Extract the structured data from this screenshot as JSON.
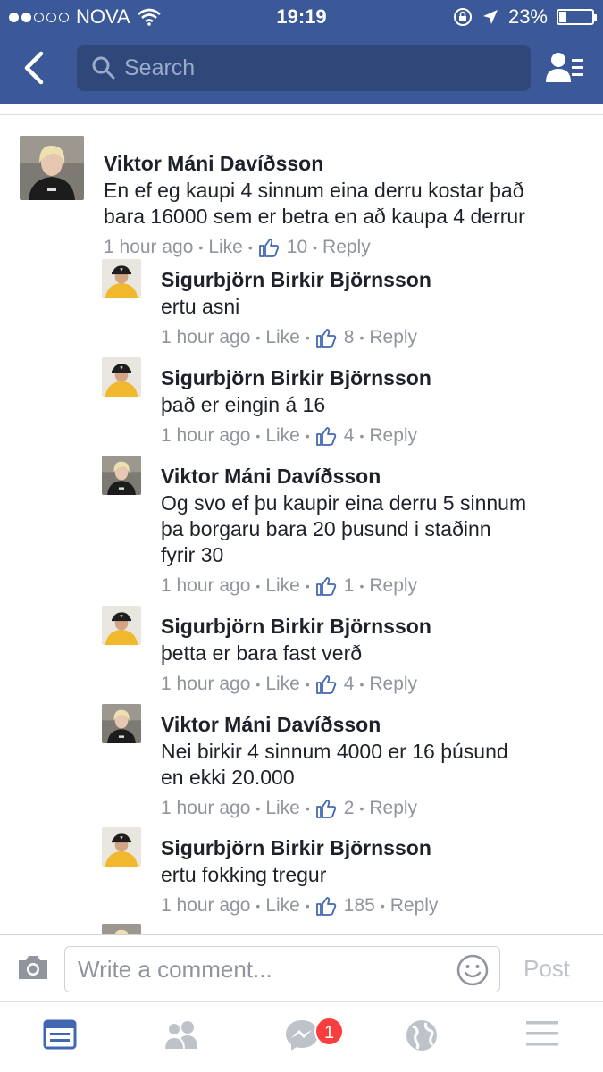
{
  "status_bar": {
    "carrier": "NOVA",
    "time": "19:19",
    "battery": "23%",
    "battery_level": 0.23
  },
  "nav": {
    "search_placeholder": "Search"
  },
  "comments": [
    {
      "name": "Viktor Máni Davíðsson",
      "text": "En ef eg kaupi 4 sinnum eina derru kostar það\nbara 16000 sem er betra en að kaupa 4 derrur",
      "time": "1 hour ago",
      "like": "Like",
      "likes": "10",
      "reply": "Reply",
      "avatar": "viktor"
    },
    {
      "name": "Sigurbjörn Birkir Björnsson",
      "text": "ertu asni",
      "time": "1 hour ago",
      "like": "Like",
      "likes": "8",
      "reply": "Reply",
      "avatar": "sigurbjorn"
    },
    {
      "name": "Sigurbjörn Birkir Björnsson",
      "text": "það er eingin á 16",
      "time": "1 hour ago",
      "like": "Like",
      "likes": "4",
      "reply": "Reply",
      "avatar": "sigurbjorn"
    },
    {
      "name": "Viktor Máni Davíðsson",
      "text": "Og svo ef þu kaupir eina derru 5 sinnum\nþa borgaru bara 20 þusund i staðinn\nfyrir 30",
      "time": "1 hour ago",
      "like": "Like",
      "likes": "1",
      "reply": "Reply",
      "avatar": "viktor"
    },
    {
      "name": "Sigurbjörn Birkir Björnsson",
      "text": "þetta er bara fast verð",
      "time": "1 hour ago",
      "like": "Like",
      "likes": "4",
      "reply": "Reply",
      "avatar": "sigurbjorn"
    },
    {
      "name": "Viktor Máni Davíðsson",
      "text": "Nei birkir 4 sinnum 4000 er 16 þúsund\nen ekki 20.000",
      "time": "1 hour ago",
      "like": "Like",
      "likes": "2",
      "reply": "Reply",
      "avatar": "viktor"
    },
    {
      "name": "Sigurbjörn Birkir Björnsson",
      "text": "ertu fokking tregur",
      "time": "1 hour ago",
      "like": "Like",
      "likes": "185",
      "reply": "Reply",
      "avatar": "sigurbjorn"
    },
    {
      "name": "Viktor Máni Davíðsson",
      "text": "",
      "time": "",
      "like": "",
      "likes": "",
      "reply": "",
      "avatar": "viktor"
    }
  ],
  "composer": {
    "placeholder": "Write a comment...",
    "post_label": "Post"
  },
  "tab_bar": {
    "messenger_badge": "1"
  },
  "colors": {
    "brand": "#3b5998",
    "active_tab": "#4267b2",
    "inactive": "#bec3c9",
    "badge": "#fa3e3e"
  }
}
